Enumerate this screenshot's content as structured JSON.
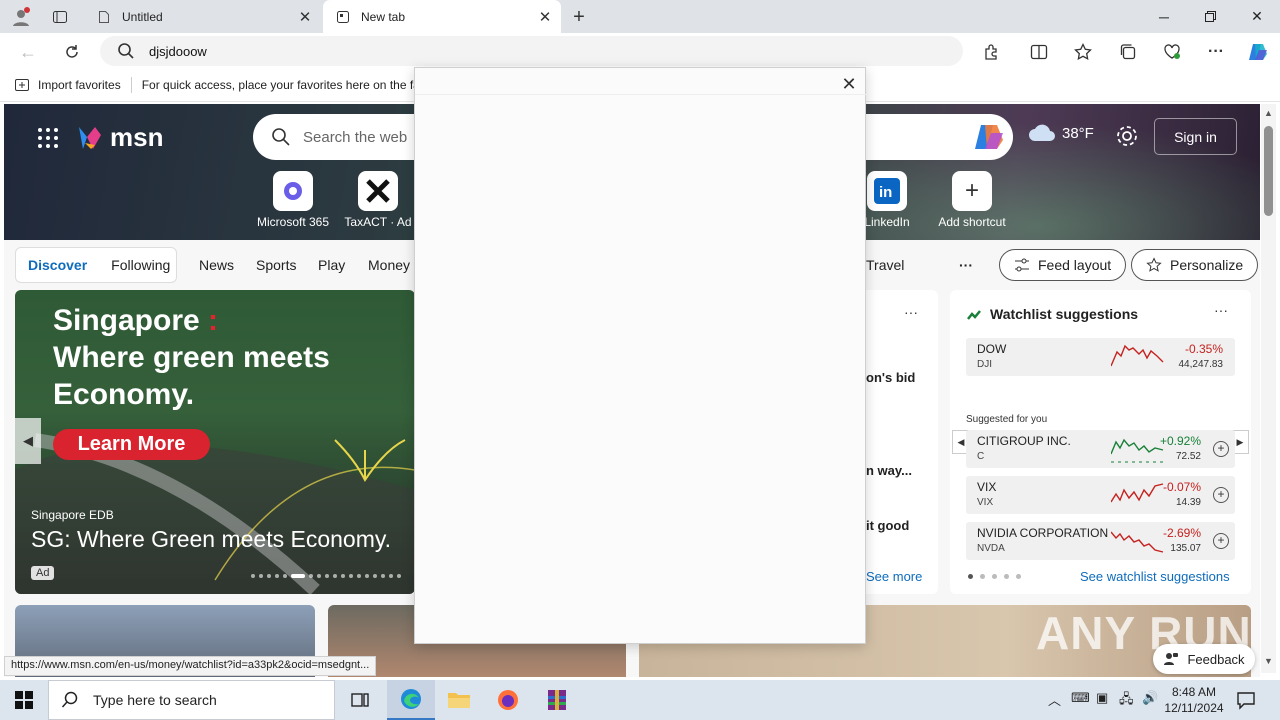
{
  "browser": {
    "tabs": [
      {
        "title": "Untitled",
        "active": false
      },
      {
        "title": "New tab",
        "active": true
      }
    ],
    "address": "djsjdooow",
    "favorites_bar": {
      "import_label": "Import favorites",
      "hint": "For quick access, place your favorites here on the fa"
    }
  },
  "msn": {
    "logo_text": "msn",
    "search_placeholder": "Search the web",
    "weather_temp": "38°F",
    "signin_label": "Sign in",
    "shortcuts": [
      {
        "label": "Microsoft 365"
      },
      {
        "label": "TaxACT · Ad"
      },
      {
        "label": "LinkedIn"
      },
      {
        "label": "Add shortcut"
      }
    ],
    "nav": {
      "discover": "Discover",
      "following": "Following",
      "links": [
        "News",
        "Sports",
        "Play",
        "Money",
        "Travel"
      ],
      "more": "···",
      "feed_layout": "Feed layout",
      "personalize": "Personalize"
    },
    "ad": {
      "headline_1": "Singapore",
      "headline_colon": ":",
      "headline_2": "Where green meets",
      "headline_3": "Economy.",
      "button": "Learn More",
      "source": "Singapore EDB",
      "title": "SG: Where Green meets Economy.",
      "badge": "Ad"
    },
    "mid_card": {
      "more": "···",
      "line1": "on's bid",
      "line2": "n way...",
      "line3": "it good",
      "see_more": "See more"
    },
    "watchlist": {
      "title": "Watchlist suggestions",
      "more": "···",
      "suggested_label": "Suggested for you",
      "see_link": "See watchlist suggestions",
      "items": [
        {
          "name": "DOW",
          "ticker": "DJI",
          "change": "-0.35%",
          "price": "44,247.83",
          "direction": "down"
        },
        {
          "name": "CITIGROUP INC.",
          "ticker": "C",
          "change": "+0.92%",
          "price": "72.52",
          "direction": "up"
        },
        {
          "name": "VIX",
          "ticker": "VIX",
          "change": "-0.07%",
          "price": "14.39",
          "direction": "down"
        },
        {
          "name": "NVIDIA CORPORATION",
          "ticker": "NVDA",
          "change": "-2.69%",
          "price": "135.07",
          "direction": "down"
        }
      ]
    },
    "feedback_label": "Feedback"
  },
  "watermark": "ANY RUN",
  "status_url": "https://www.msn.com/en-us/money/watchlist?id=a33pk2&ocid=msedgnt...",
  "taskbar": {
    "search_placeholder": "Type here to search",
    "time": "8:48 AM",
    "date": "12/11/2024"
  },
  "colors": {
    "accent": "#0f6cbd",
    "up": "#188038",
    "down": "#c5221f"
  }
}
